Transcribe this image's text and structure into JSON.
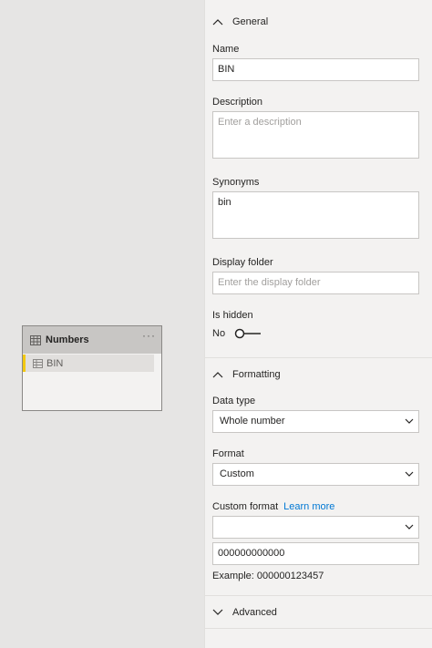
{
  "canvas": {
    "table": {
      "title": "Numbers",
      "more": "···",
      "fields": [
        {
          "label": "BIN"
        }
      ]
    }
  },
  "pane": {
    "general": {
      "header": "General",
      "name_label": "Name",
      "name_value": "BIN",
      "description_label": "Description",
      "description_placeholder": "Enter a description",
      "synonyms_label": "Synonyms",
      "synonyms_value": "bin",
      "display_folder_label": "Display folder",
      "display_folder_placeholder": "Enter the display folder",
      "is_hidden_label": "Is hidden",
      "is_hidden_value": "No"
    },
    "formatting": {
      "header": "Formatting",
      "data_type_label": "Data type",
      "data_type_value": "Whole number",
      "format_label": "Format",
      "format_value": "Custom",
      "custom_format_label": "Custom format",
      "learn_more": "Learn more",
      "custom_format_dropdown_value": "",
      "custom_format_value": "000000000000",
      "example_text": "Example: 000000123457"
    },
    "advanced": {
      "header": "Advanced"
    }
  },
  "colors": {
    "accent_yellow": "#f2c811",
    "link_blue": "#0078d4"
  }
}
